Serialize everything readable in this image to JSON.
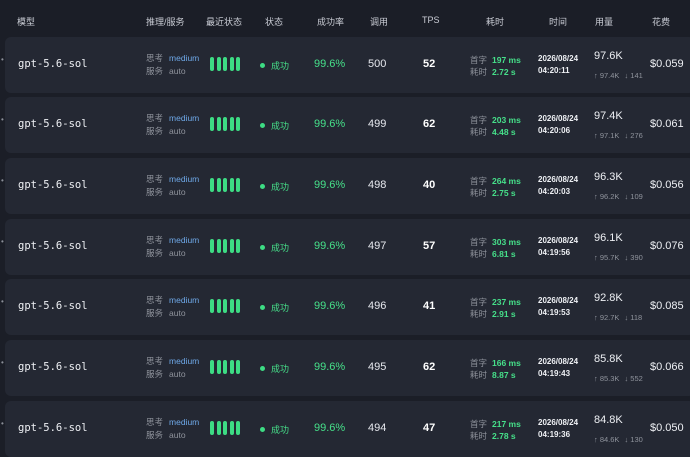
{
  "header": {
    "model": "模型",
    "reasoning": "推理/服务",
    "recent": "最近状态",
    "status": "状态",
    "success_rate": "成功率",
    "calls": "调用",
    "tps": "TPS",
    "latency": "耗时",
    "time": "时间",
    "usage": "用量",
    "cost": "花费"
  },
  "labels": {
    "think": "思考",
    "service": "服务",
    "first_token": "首字",
    "elapsed": "耗时"
  },
  "colors": {
    "background": "#1b1e27",
    "row_bg": "#242833",
    "success_green": "#3ddc84",
    "reasoning_blue": "#6ea8e8"
  },
  "rows": [
    {
      "model": "gpt-5.6-sol",
      "think": "medium",
      "service": "auto",
      "status": "成功",
      "rate": "99.6%",
      "calls": "500",
      "tps": "52",
      "first": "197 ms",
      "elapsed": "2.72 s",
      "date": "2026/08/24",
      "clock": "04:20:11",
      "usage": "97.6K",
      "up": "↑ 97.4K",
      "down": "↓ 141",
      "cost": "$0.059"
    },
    {
      "model": "gpt-5.6-sol",
      "think": "medium",
      "service": "auto",
      "status": "成功",
      "rate": "99.6%",
      "calls": "499",
      "tps": "62",
      "first": "203 ms",
      "elapsed": "4.48 s",
      "date": "2026/08/24",
      "clock": "04:20:06",
      "usage": "97.4K",
      "up": "↑ 97.1K",
      "down": "↓ 276",
      "cost": "$0.061"
    },
    {
      "model": "gpt-5.6-sol",
      "think": "medium",
      "service": "auto",
      "status": "成功",
      "rate": "99.6%",
      "calls": "498",
      "tps": "40",
      "first": "264 ms",
      "elapsed": "2.75 s",
      "date": "2026/08/24",
      "clock": "04:20:03",
      "usage": "96.3K",
      "up": "↑ 96.2K",
      "down": "↓ 109",
      "cost": "$0.056"
    },
    {
      "model": "gpt-5.6-sol",
      "think": "medium",
      "service": "auto",
      "status": "成功",
      "rate": "99.6%",
      "calls": "497",
      "tps": "57",
      "first": "303 ms",
      "elapsed": "6.81 s",
      "date": "2026/08/24",
      "clock": "04:19:56",
      "usage": "96.1K",
      "up": "↑ 95.7K",
      "down": "↓ 390",
      "cost": "$0.076"
    },
    {
      "model": "gpt-5.6-sol",
      "think": "medium",
      "service": "auto",
      "status": "成功",
      "rate": "99.6%",
      "calls": "496",
      "tps": "41",
      "first": "237 ms",
      "elapsed": "2.91 s",
      "date": "2026/08/24",
      "clock": "04:19:53",
      "usage": "92.8K",
      "up": "↑ 92.7K",
      "down": "↓ 118",
      "cost": "$0.085"
    },
    {
      "model": "gpt-5.6-sol",
      "think": "medium",
      "service": "auto",
      "status": "成功",
      "rate": "99.6%",
      "calls": "495",
      "tps": "62",
      "first": "166 ms",
      "elapsed": "8.87 s",
      "date": "2026/08/24",
      "clock": "04:19:43",
      "usage": "85.8K",
      "up": "↑ 85.3K",
      "down": "↓ 552",
      "cost": "$0.066"
    },
    {
      "model": "gpt-5.6-sol",
      "think": "medium",
      "service": "auto",
      "status": "成功",
      "rate": "99.6%",
      "calls": "494",
      "tps": "47",
      "first": "217 ms",
      "elapsed": "2.78 s",
      "date": "2026/08/24",
      "clock": "04:19:36",
      "usage": "84.8K",
      "up": "↑ 84.6K",
      "down": "↓ 130",
      "cost": "$0.050"
    }
  ]
}
